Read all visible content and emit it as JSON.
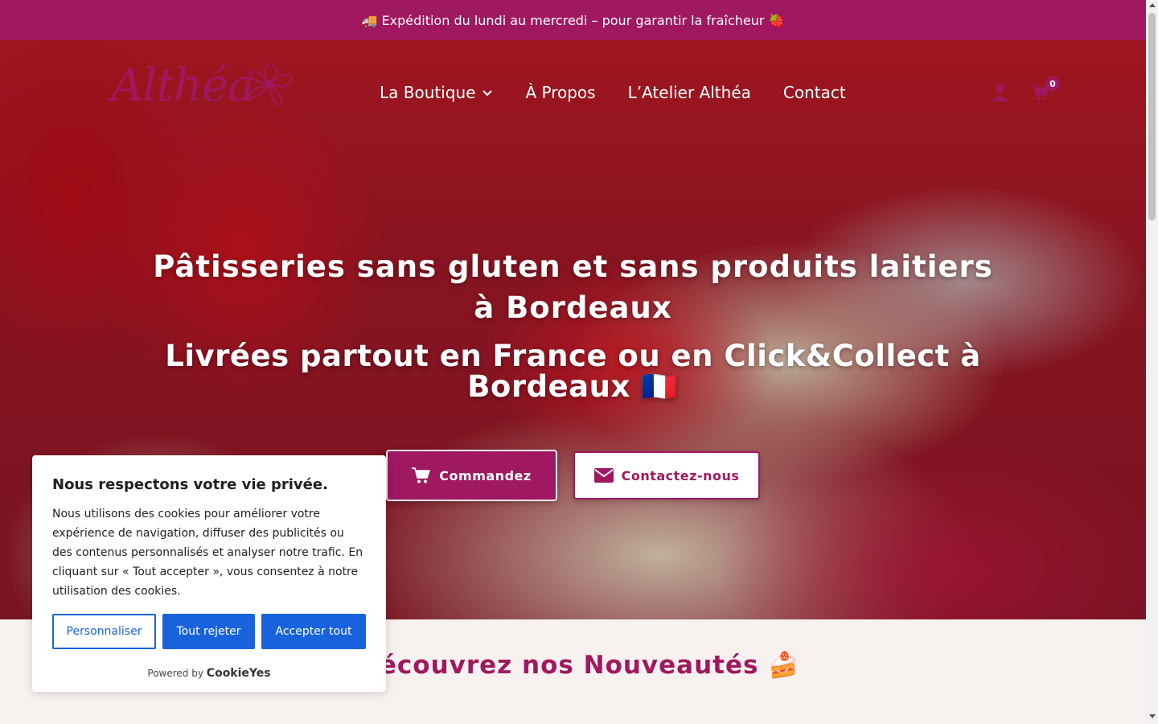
{
  "topbar": {
    "text": "🚚 Expédition du lundi au mercredi – pour garantir la fraîcheur 🍓"
  },
  "header": {
    "logo_text": "Althéa",
    "nav": [
      {
        "label": "La Boutique",
        "icon": "chevron-down-icon"
      },
      {
        "label": "À Propos"
      },
      {
        "label": "L’Atelier Althéa"
      },
      {
        "label": "Contact"
      }
    ],
    "account_icon": "user-icon",
    "cart": {
      "icon": "shopping-cart-icon",
      "count": "0"
    }
  },
  "hero": {
    "title": "Pâtisseries sans gluten et sans produits laitiers à Bordeaux",
    "subtitle": "Livrées partout en France ou en Click&Collect à Bordeaux 🇫🇷",
    "order_button": "Commandez",
    "contact_button": "Contactez-nous"
  },
  "section": {
    "title": "Découvrez nos Nouveautés 🍰"
  },
  "cookie": {
    "title": "Nous respectons votre vie privée.",
    "text": "Nous utilisons des cookies pour améliorer votre expérience de navigation, diffuser des publicités ou des contenus personnalisés et analyser notre trafic. En cliquant sur « Tout accepter », vous consentez à notre utilisation des cookies.",
    "customize": "Personnaliser",
    "reject": "Tout rejeter",
    "accept": "Accepter tout",
    "powered_by": "Powered by",
    "brand": "CookieYes"
  },
  "colors": {
    "brand": "#a0185f",
    "cookie_button": "#1863dc",
    "section_bg": "#f7f1ef"
  }
}
